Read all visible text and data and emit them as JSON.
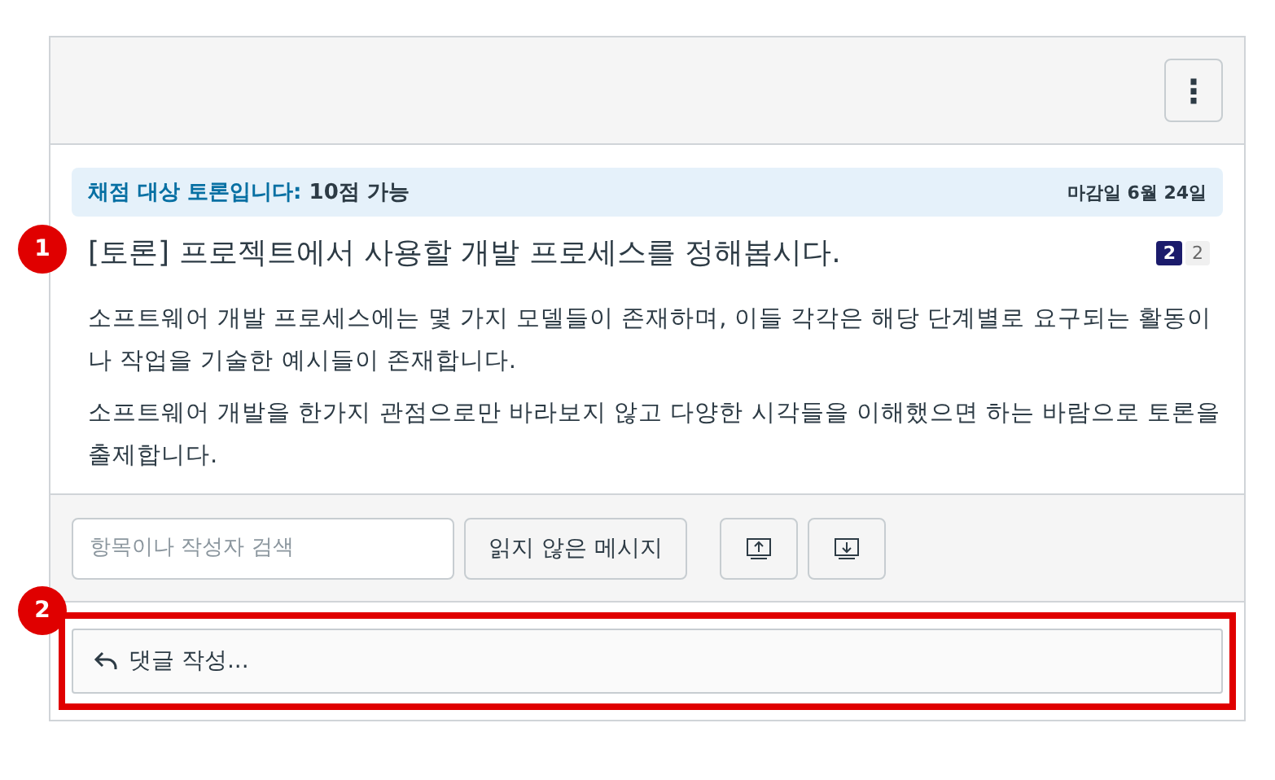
{
  "header": {
    "menu_button": "⋮"
  },
  "banner": {
    "label": "채점 대상 토론입니다:",
    "points": "10점 가능",
    "due": "마감일 6월 24일"
  },
  "topic": {
    "title": "[토론] 프로젝트에서 사용할 개발 프로세스를 정해봅시다.",
    "unread_count": "2",
    "total_count": "2"
  },
  "paragraphs": [
    "소프트웨어 개발 프로세스에는 몇 가지 모델들이 존재하며, 이들 각각은 해당 단계별로 요구되는 활동이나 작업을 기술한 예시들이 존재합니다.",
    "소프트웨어 개발을 한가지 관점으로만 바라보지 않고 다양한 시각들을 이해했으면 하는 바람으로 토론을 출제합니다."
  ],
  "toolbar": {
    "search": {
      "placeholder": "항목이나 작성자 검색"
    },
    "unread_button": "읽지 않은 메시지"
  },
  "reply": {
    "label": "댓글 작성..."
  },
  "callouts": [
    {
      "number": "1"
    },
    {
      "number": "2"
    }
  ]
}
